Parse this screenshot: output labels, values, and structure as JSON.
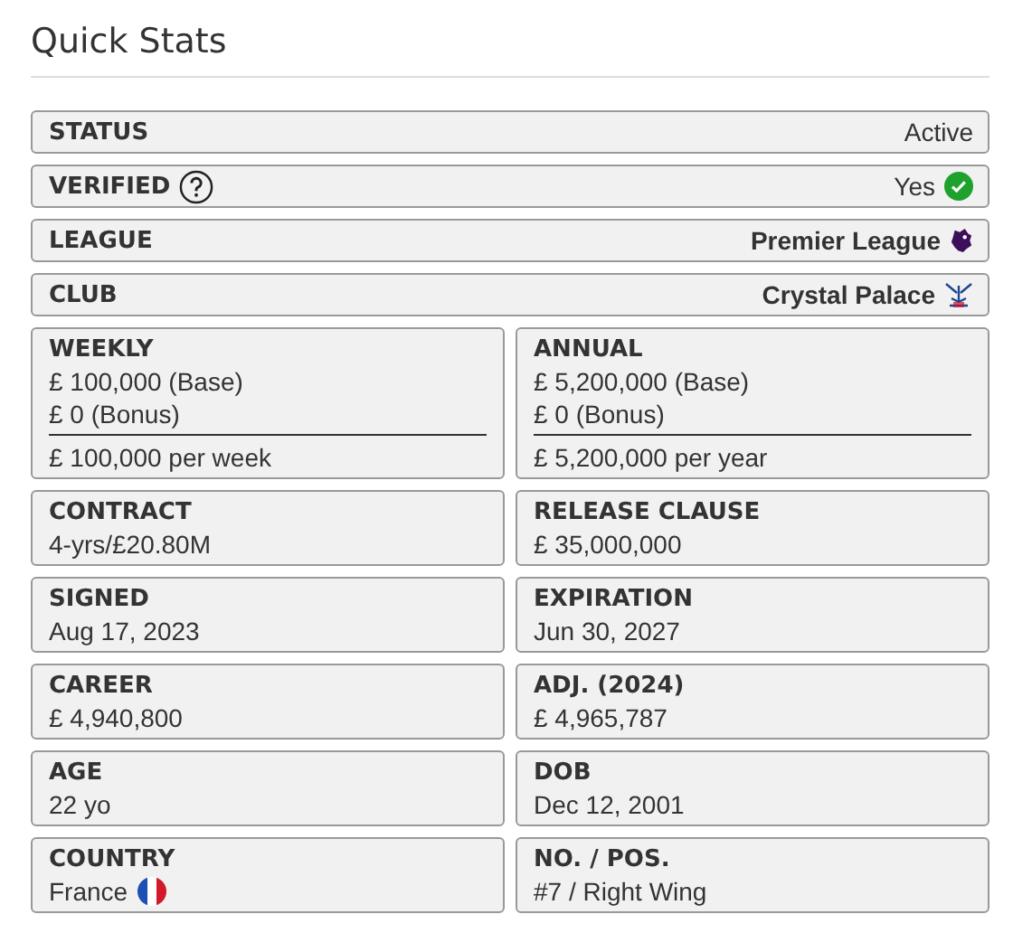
{
  "title": "Quick Stats",
  "rows": [
    {
      "label": "STATUS",
      "value": "Active",
      "kind": "plain"
    },
    {
      "label": "VERIFIED",
      "value": "Yes",
      "kind": "verified"
    },
    {
      "label": "LEAGUE",
      "value": "Premier League",
      "kind": "league"
    },
    {
      "label": "CLUB",
      "value": "Crystal Palace",
      "kind": "club"
    }
  ],
  "cards": [
    {
      "label": "WEEKLY",
      "kind": "breakdown",
      "lines": [
        "£ 100,000 (Base)",
        "£ 0 (Bonus)"
      ],
      "total": "£ 100,000 per week"
    },
    {
      "label": "ANNUAL",
      "kind": "breakdown",
      "lines": [
        "£ 5,200,000 (Base)",
        "£ 0 (Bonus)"
      ],
      "total": "£ 5,200,000 per year"
    },
    {
      "label": "CONTRACT",
      "kind": "plain",
      "value": "4-yrs/£20.80M"
    },
    {
      "label": "RELEASE CLAUSE",
      "kind": "plain",
      "value": "£ 35,000,000"
    },
    {
      "label": "SIGNED",
      "kind": "plain",
      "value": "Aug 17, 2023"
    },
    {
      "label": "EXPIRATION",
      "kind": "plain",
      "value": "Jun 30, 2027"
    },
    {
      "label": "CAREER",
      "kind": "plain",
      "value": "£ 4,940,800"
    },
    {
      "label": "ADJ. (2024)",
      "kind": "plain",
      "value": "£ 4,965,787"
    },
    {
      "label": "AGE",
      "kind": "plain",
      "value": "22 yo"
    },
    {
      "label": "DOB",
      "kind": "plain",
      "value": "Dec 12, 2001"
    },
    {
      "label": "COUNTRY",
      "kind": "flag",
      "value": "France"
    },
    {
      "label": "NO. / POS.",
      "kind": "plain",
      "value": "#7 / Right Wing"
    }
  ]
}
